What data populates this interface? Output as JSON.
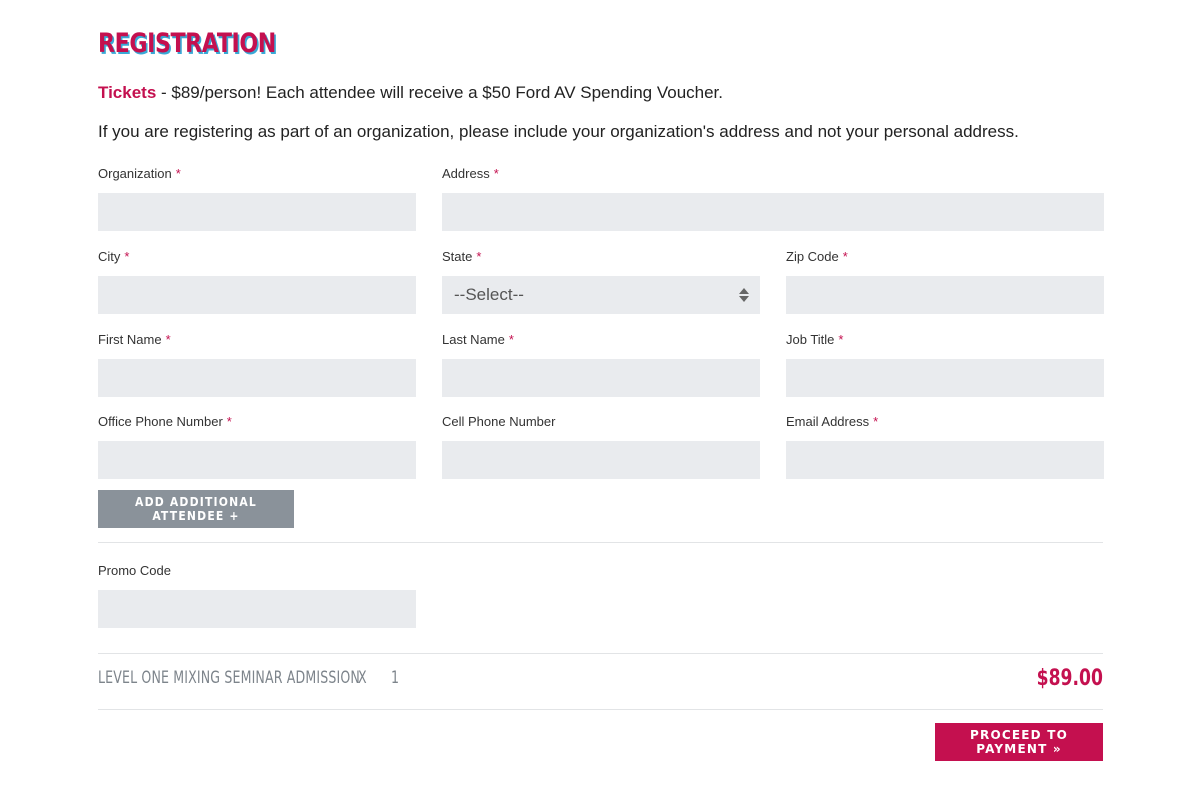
{
  "page": {
    "title": "REGISTRATION",
    "tickets_label": "Tickets",
    "tickets_text": " - $89/person! Each attendee will receive a $50 Ford AV Spending Voucher.",
    "org_notice": "If you are registering as part of an organization, please include your organization's address and not your personal address."
  },
  "colors": {
    "accent": "#c4104f",
    "title_shadow": "#39a9d6",
    "input_bg": "#e9ebee",
    "secondary_button": "#8a929a"
  },
  "form": {
    "required_marker": "*",
    "organization": {
      "label": "Organization",
      "value": ""
    },
    "address": {
      "label": "Address",
      "value": ""
    },
    "city": {
      "label": "City",
      "value": ""
    },
    "state": {
      "label": "State",
      "selected": "--Select--"
    },
    "zip": {
      "label": "Zip Code",
      "value": ""
    },
    "first_name": {
      "label": "First Name",
      "value": ""
    },
    "last_name": {
      "label": "Last Name",
      "value": ""
    },
    "job_title": {
      "label": "Job Title",
      "value": ""
    },
    "office_phone": {
      "label": "Office Phone Number",
      "value": ""
    },
    "cell_phone": {
      "label": "Cell Phone Number",
      "value": ""
    },
    "email": {
      "label": "Email Address",
      "value": ""
    },
    "add_attendee_label": "ADD ADDITIONAL ATTENDEE +",
    "promo": {
      "label": "Promo Code",
      "value": ""
    }
  },
  "order": {
    "item_name": "LEVEL ONE MIXING SEMINAR ADMISSION",
    "times": "X",
    "quantity": "1",
    "price": "$89.00"
  },
  "actions": {
    "proceed_label": "PROCEED TO PAYMENT »"
  }
}
